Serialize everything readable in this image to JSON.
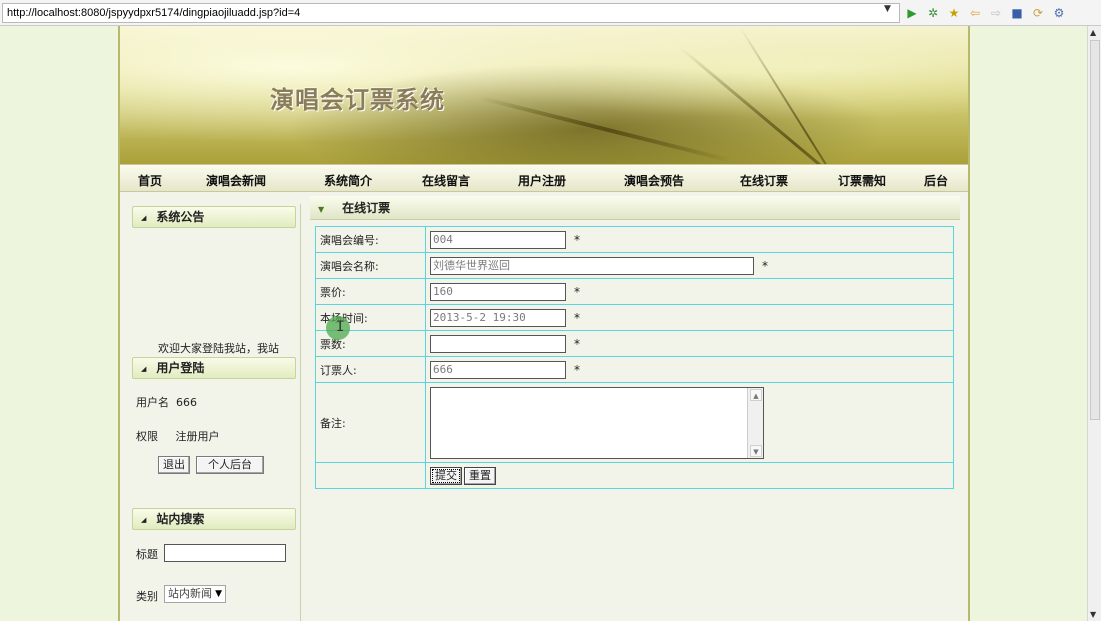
{
  "browser": {
    "url": "http://localhost:8080/jspyydpxr5174/dingpiaojiluadd.jsp?id=4",
    "dropdown_icon": "chevron-down-icon",
    "toolbar_icons": [
      "run-icon",
      "debug-icon",
      "favorite-icon",
      "back-icon",
      "forward-icon",
      "stop-icon",
      "refresh-icon",
      "perspective-icon"
    ]
  },
  "banner": {
    "title": "演唱会订票系统"
  },
  "nav": {
    "items": [
      "首页",
      "演唱会新闻",
      "系统简介",
      "在线留言",
      "用户注册",
      "演唱会预告",
      "在线订票",
      "订票需知",
      "后台"
    ]
  },
  "sidebar": {
    "announcement": {
      "title": "系统公告",
      "text": "欢迎大家登陆我站，我站"
    },
    "login": {
      "title": "用户登陆",
      "username_label": "用户名",
      "username_value": "666",
      "role_label": "权限",
      "role_value": "注册用户",
      "logout_button": "退出",
      "dashboard_button": "个人后台"
    },
    "search": {
      "title": "站内搜索",
      "title_label": "标题",
      "title_value": "",
      "category_label": "类别",
      "category_value": "站内新闻"
    }
  },
  "main": {
    "title": "在线订票",
    "form": {
      "concert_id": {
        "label": "演唱会编号:",
        "value": "004"
      },
      "concert_name": {
        "label": "演唱会名称:",
        "value": "刘德华世界巡回"
      },
      "price": {
        "label": "票价:",
        "value": "160"
      },
      "show_time": {
        "label": "本场时间:",
        "value": "2013-5-2 19:30"
      },
      "ticket_count": {
        "label": "票数:",
        "value": ""
      },
      "booker": {
        "label": "订票人:",
        "value": "666"
      },
      "remarks": {
        "label": "备注:",
        "value": ""
      },
      "required_mark": "*",
      "submit_button": "提交",
      "reset_button": "重置"
    }
  },
  "colors": {
    "table_border": "#59d5de",
    "banner_accent": "#aaa03a",
    "sidebar_head": "#e1ecc0"
  }
}
